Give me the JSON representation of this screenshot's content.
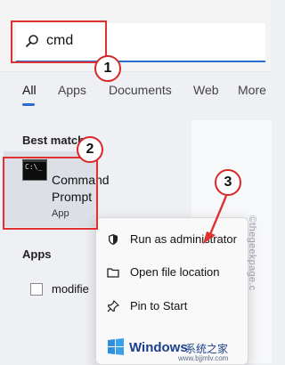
{
  "search": {
    "value": "cmd"
  },
  "tabs": [
    {
      "label": "All"
    },
    {
      "label": "Apps"
    },
    {
      "label": "Documents"
    },
    {
      "label": "Web"
    },
    {
      "label": "More"
    }
  ],
  "best_match": {
    "section_title": "Best match",
    "name_line1": "Command",
    "name_line2": "Prompt",
    "kind": "App"
  },
  "apps": {
    "section_title": "Apps",
    "item_label": "modifie"
  },
  "context_menu": {
    "items": [
      {
        "label": "Run as administrator",
        "icon": "shield-icon"
      },
      {
        "label": "Open file location",
        "icon": "folder-icon"
      },
      {
        "label": "Pin to Start",
        "icon": "pin-icon"
      }
    ]
  },
  "badges": [
    "1",
    "2",
    "3"
  ],
  "watermark": {
    "side_text": "©thegeekpage.c",
    "brand": "Windows",
    "brand_cn": "系统之家",
    "url": "www.bjjmlv.com"
  },
  "colors": {
    "accent": "#2a6fd6",
    "highlight": "#e03131"
  }
}
